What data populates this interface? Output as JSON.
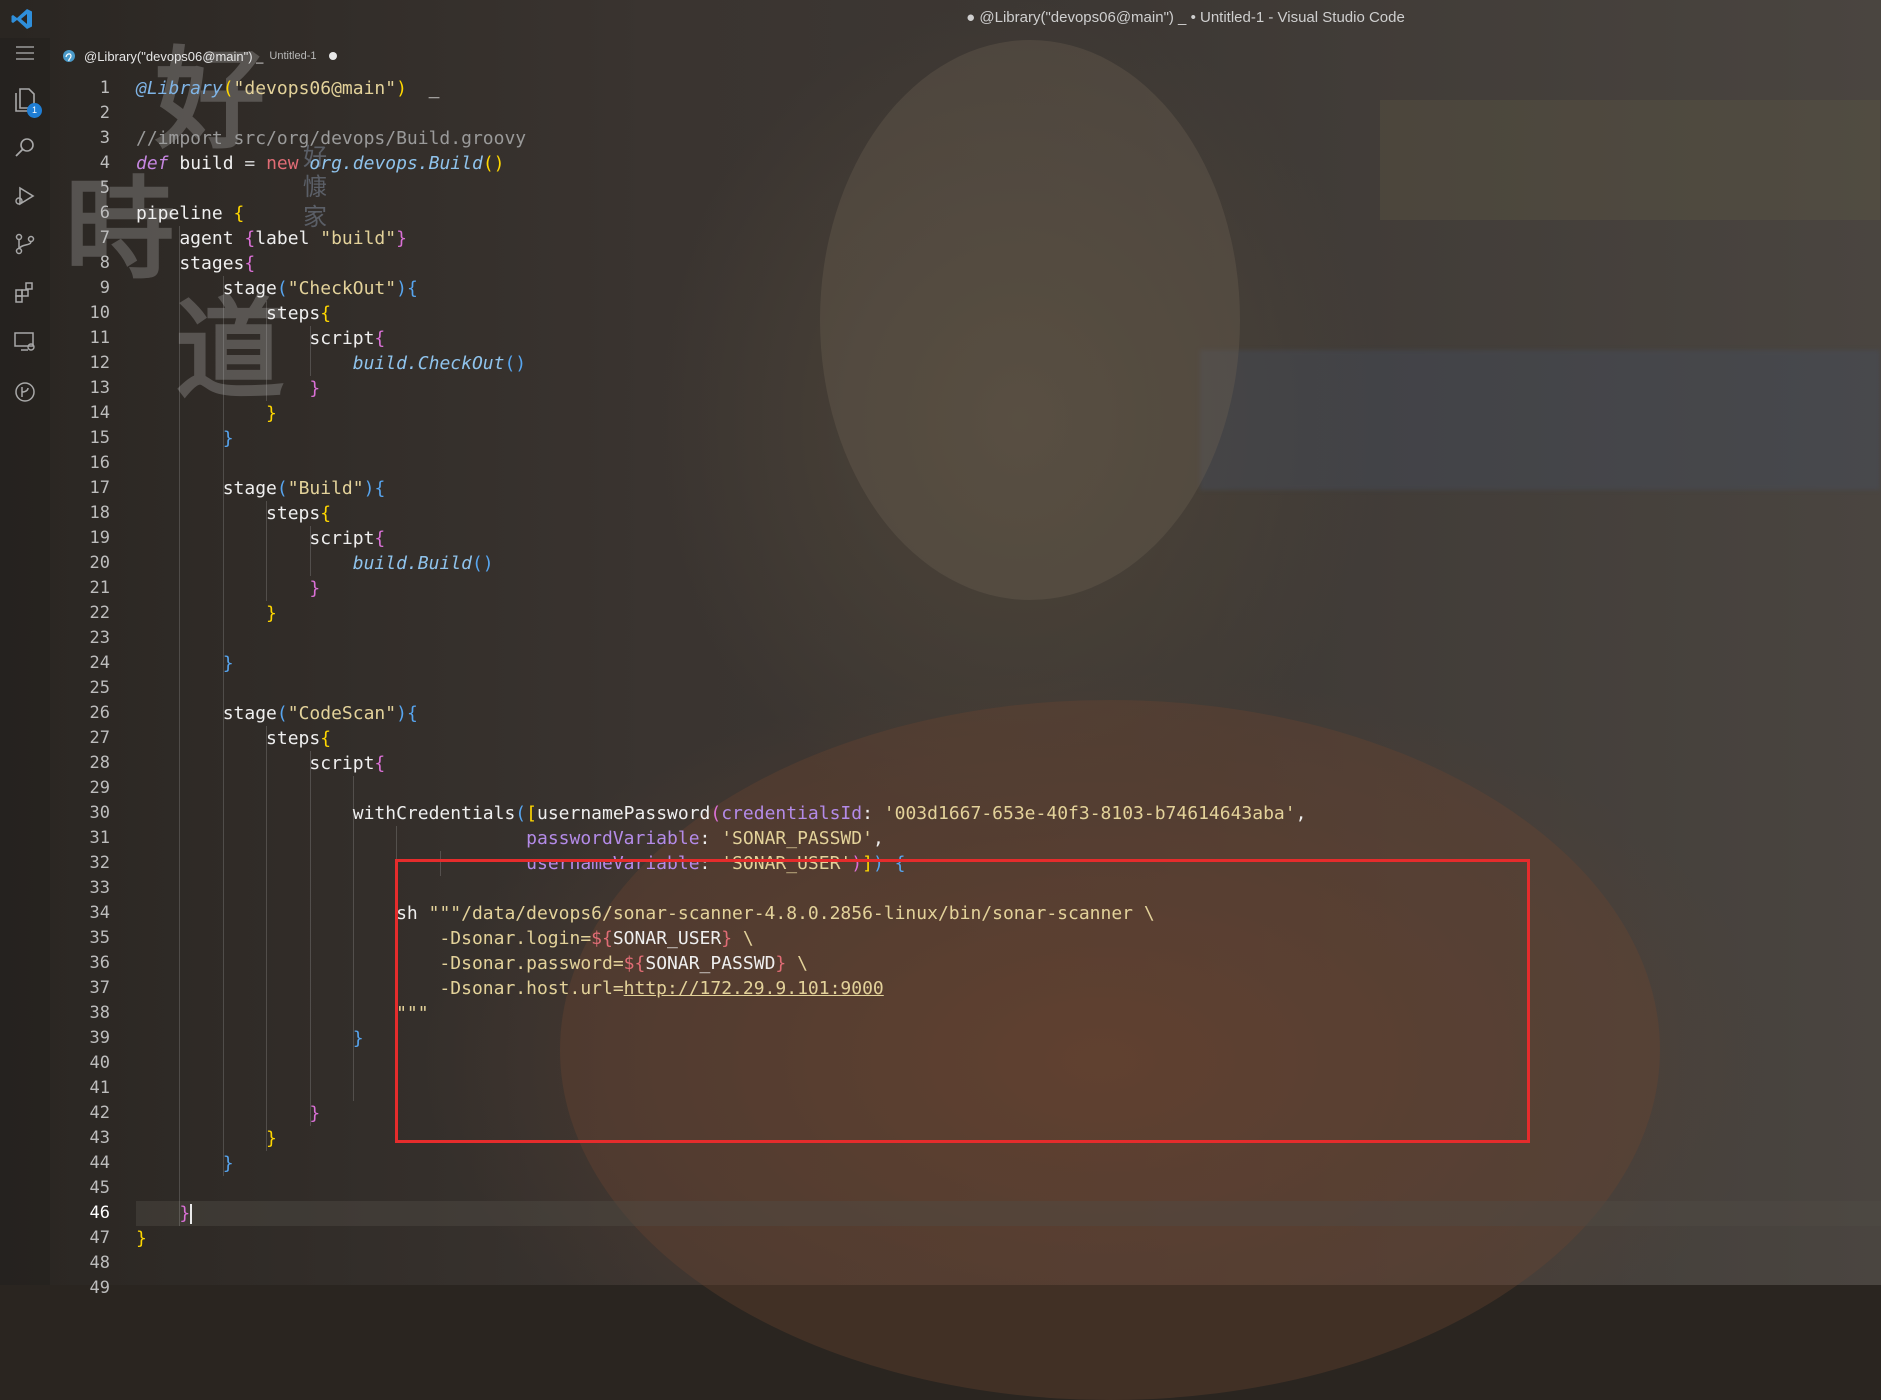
{
  "window": {
    "title": "● @Library(\"devops06@main\") _ • Untitled-1 - Visual Studio Code"
  },
  "activity_bar": {
    "items": [
      {
        "icon": "explorer-icon",
        "badge": "1"
      },
      {
        "icon": "search-icon"
      },
      {
        "icon": "run-debug-icon"
      },
      {
        "icon": "source-control-icon"
      },
      {
        "icon": "extensions-icon"
      },
      {
        "icon": "remote-explorer-icon"
      },
      {
        "icon": "gitlens-icon"
      }
    ]
  },
  "tab": {
    "label": "@Library(\"devops06@main\") _",
    "sublabel": "Untitled-1",
    "dirty": true
  },
  "editor": {
    "active_line": 46,
    "line_numbers": [
      "1",
      "2",
      "3",
      "4",
      "5",
      "6",
      "7",
      "8",
      "9",
      "10",
      "11",
      "12",
      "13",
      "14",
      "15",
      "16",
      "17",
      "18",
      "19",
      "20",
      "21",
      "22",
      "23",
      "24",
      "25",
      "26",
      "27",
      "28",
      "29",
      "30",
      "31",
      "32",
      "33",
      "34",
      "35",
      "36",
      "37",
      "38",
      "39",
      "40",
      "41",
      "42",
      "43",
      "44",
      "45",
      "46",
      "47",
      "48",
      "49"
    ],
    "lines": [
      [
        [
          "ann",
          "@Library"
        ],
        [
          "b1",
          "("
        ],
        [
          "str",
          "\"devops06@main\""
        ],
        [
          "b1",
          ")"
        ],
        [
          "",
          "  _"
        ]
      ],
      [],
      [
        [
          "cmt",
          "//import src/org/devops/Build.groovy"
        ]
      ],
      [
        [
          "kw",
          "def"
        ],
        [
          "",
          " build "
        ],
        [
          "op",
          "="
        ],
        [
          "",
          " "
        ],
        [
          "new",
          "new"
        ],
        [
          "",
          " "
        ],
        [
          "fn",
          "org.devops.Build"
        ],
        [
          "b1",
          "()"
        ]
      ],
      [],
      [
        [
          "",
          "pipeline "
        ],
        [
          "b1",
          "{"
        ]
      ],
      [
        [
          "",
          "    agent "
        ],
        [
          "b2",
          "{"
        ],
        [
          "",
          "label "
        ],
        [
          "str",
          "\"build\""
        ],
        [
          "b2",
          "}"
        ]
      ],
      [
        [
          "",
          "    stages"
        ],
        [
          "b2",
          "{"
        ]
      ],
      [
        [
          "",
          "        stage"
        ],
        [
          "b3",
          "("
        ],
        [
          "str",
          "\"CheckOut\""
        ],
        [
          "b3",
          ")"
        ],
        [
          "b3",
          "{"
        ]
      ],
      [
        [
          "",
          "            steps"
        ],
        [
          "b1",
          "{"
        ]
      ],
      [
        [
          "",
          "                script"
        ],
        [
          "b2",
          "{"
        ]
      ],
      [
        [
          "",
          "                    "
        ],
        [
          "fn",
          "build.CheckOut"
        ],
        [
          "b3",
          "()"
        ]
      ],
      [
        [
          "",
          "                "
        ],
        [
          "b2",
          "}"
        ]
      ],
      [
        [
          "",
          "            "
        ],
        [
          "b1",
          "}"
        ]
      ],
      [
        [
          "",
          "        "
        ],
        [
          "b3",
          "}"
        ]
      ],
      [],
      [
        [
          "",
          "        stage"
        ],
        [
          "b3",
          "("
        ],
        [
          "str",
          "\"Build\""
        ],
        [
          "b3",
          ")"
        ],
        [
          "b3",
          "{"
        ]
      ],
      [
        [
          "",
          "            steps"
        ],
        [
          "b1",
          "{"
        ]
      ],
      [
        [
          "",
          "                script"
        ],
        [
          "b2",
          "{"
        ]
      ],
      [
        [
          "",
          "                    "
        ],
        [
          "fn",
          "build.Build"
        ],
        [
          "b3",
          "()"
        ]
      ],
      [
        [
          "",
          "                "
        ],
        [
          "b2",
          "}"
        ]
      ],
      [
        [
          "",
          "            "
        ],
        [
          "b1",
          "}"
        ]
      ],
      [],
      [
        [
          "",
          "        "
        ],
        [
          "b3",
          "}"
        ]
      ],
      [],
      [
        [
          "",
          "        stage"
        ],
        [
          "b3",
          "("
        ],
        [
          "str",
          "\"CodeScan\""
        ],
        [
          "b3",
          ")"
        ],
        [
          "b3",
          "{"
        ]
      ],
      [
        [
          "",
          "            steps"
        ],
        [
          "b1",
          "{"
        ]
      ],
      [
        [
          "",
          "                script"
        ],
        [
          "b2",
          "{"
        ]
      ],
      [],
      [
        [
          "",
          "                    withCredentials"
        ],
        [
          "b3",
          "("
        ],
        [
          "b1",
          "["
        ],
        [
          "",
          "usernamePassword"
        ],
        [
          "b2",
          "("
        ],
        [
          "prm",
          "credentialsId"
        ],
        [
          "",
          ": "
        ],
        [
          "str",
          "'003d1667-653e-40f3-8103-b74614643aba'"
        ],
        [
          "",
          ","
        ]
      ],
      [
        [
          "",
          "                                    "
        ],
        [
          "prm",
          "passwordVariable"
        ],
        [
          "",
          ": "
        ],
        [
          "str",
          "'SONAR_PASSWD'"
        ],
        [
          "",
          ","
        ]
      ],
      [
        [
          "",
          "                                    "
        ],
        [
          "prm",
          "usernameVariable"
        ],
        [
          "",
          ": "
        ],
        [
          "str",
          "'SONAR_USER'"
        ],
        [
          "b2",
          ")"
        ],
        [
          "b1",
          "]"
        ],
        [
          "b3",
          ")"
        ],
        [
          "",
          " "
        ],
        [
          "b3",
          "{"
        ]
      ],
      [],
      [
        [
          "",
          "                        sh "
        ],
        [
          "str",
          "\"\"\"/data/devops6/sonar-scanner-4.8.0.2856-linux/bin/sonar-scanner \\"
        ]
      ],
      [
        [
          "str",
          "                            -Dsonar.login="
        ],
        [
          "new",
          "${"
        ],
        [
          "",
          "SONAR_USER"
        ],
        [
          "new",
          "}"
        ],
        [
          "str",
          " \\"
        ]
      ],
      [
        [
          "str",
          "                            -Dsonar.password="
        ],
        [
          "new",
          "${"
        ],
        [
          "",
          "SONAR_PASSWD"
        ],
        [
          "new",
          "}"
        ],
        [
          "str",
          " \\"
        ]
      ],
      [
        [
          "str",
          "                            -Dsonar.host.url="
        ],
        [
          "url",
          "http://172.29.9.101:9000"
        ]
      ],
      [
        [
          "str",
          "                        \"\"\""
        ]
      ],
      [
        [
          "",
          "                    "
        ],
        [
          "b3",
          "}"
        ]
      ],
      [],
      [],
      [
        [
          "",
          "                "
        ],
        [
          "b2",
          "}"
        ]
      ],
      [
        [
          "",
          "            "
        ],
        [
          "b1",
          "}"
        ]
      ],
      [
        [
          "",
          "        "
        ],
        [
          "b3",
          "}"
        ]
      ],
      [],
      [
        [
          "",
          "    "
        ],
        [
          "b2",
          "}"
        ]
      ],
      [
        [
          "b1",
          "}"
        ]
      ],
      [],
      []
    ]
  },
  "watermark": {
    "chars_big": [
      "好",
      "時",
      "道"
    ],
    "chars_small": [
      "好",
      "慷",
      "家"
    ]
  }
}
